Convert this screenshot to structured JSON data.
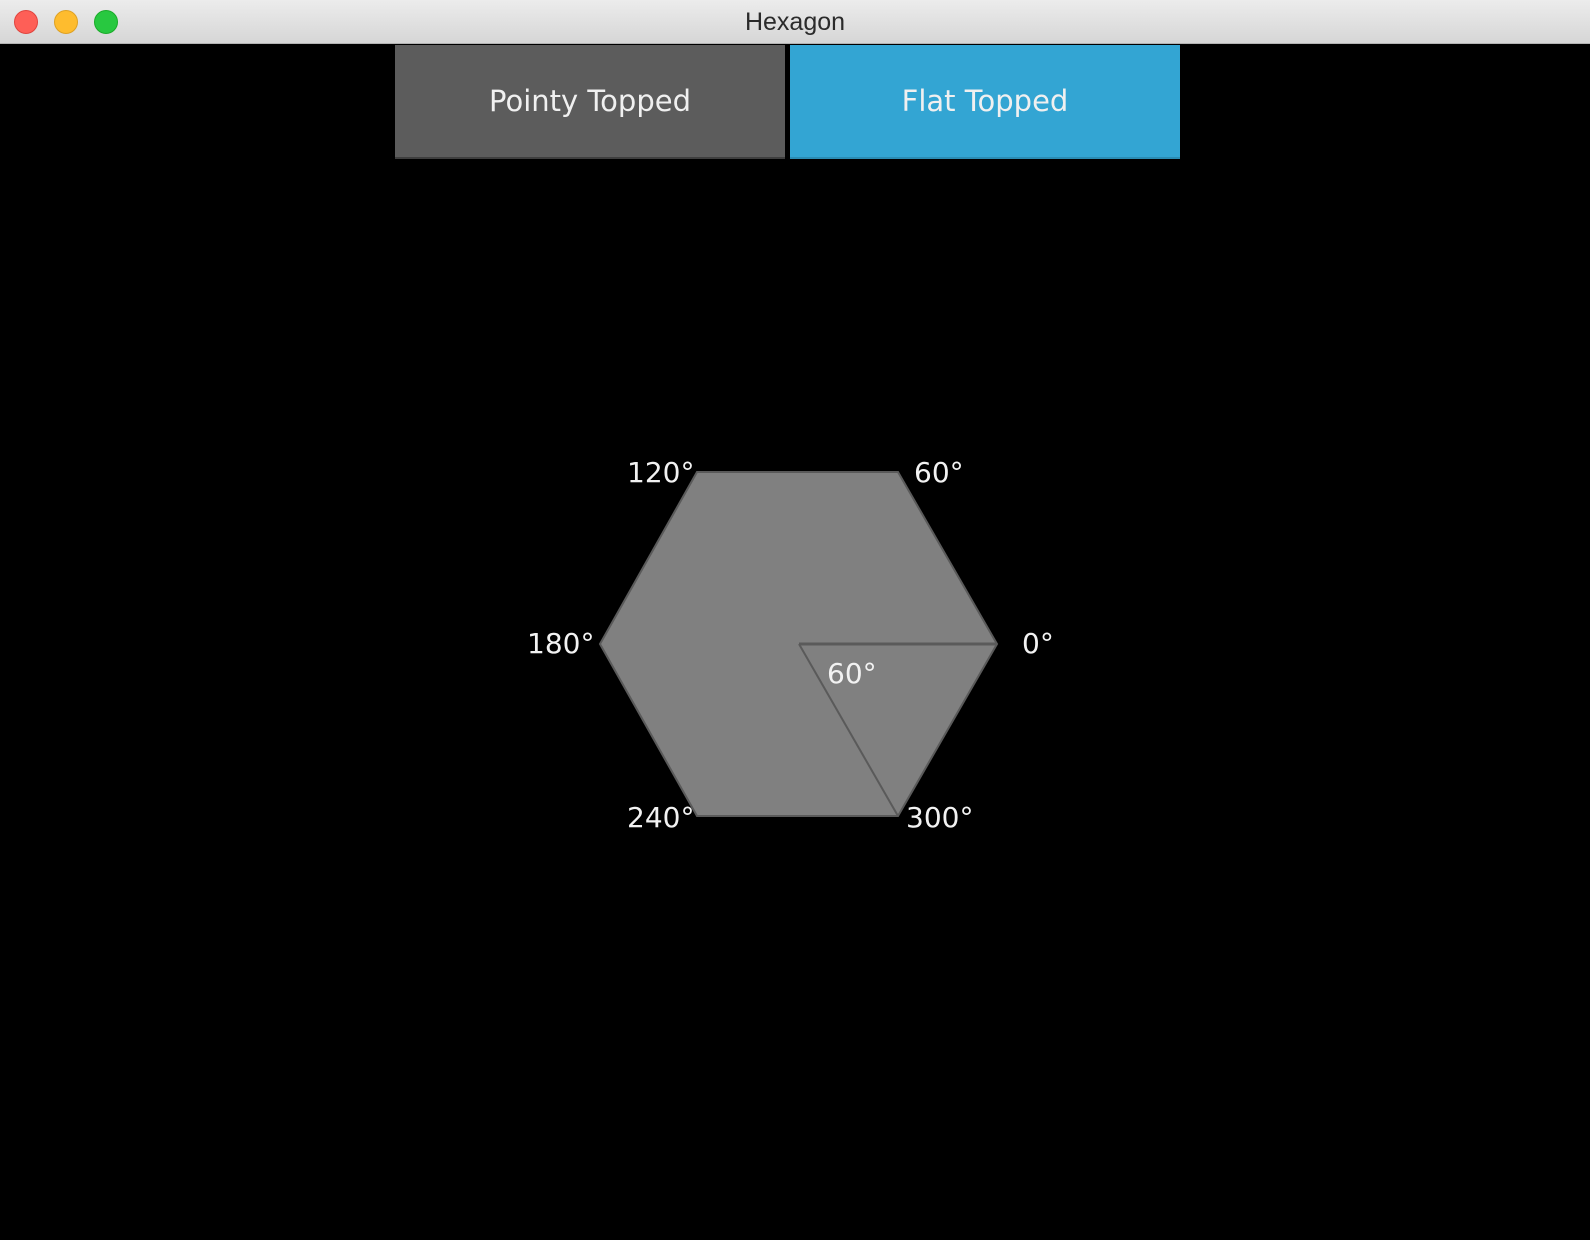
{
  "window": {
    "title": "Hexagon"
  },
  "toolbar": {
    "pointy_label": "Pointy Topped",
    "flat_label": "Flat Topped",
    "selected": "Flat Topped"
  },
  "hexagon": {
    "orientation": "flat",
    "fill_color": "#808080",
    "stroke_color": "#5a5a5a",
    "corner_labels": {
      "deg0": "0°",
      "deg60": "60°",
      "deg120": "120°",
      "deg180": "180°",
      "deg240": "240°",
      "deg300": "300°"
    },
    "center_angle_label": "60°"
  },
  "colors": {
    "selected_button": "#33a5d3",
    "unselected_button": "#5c5c5c",
    "background": "#000000"
  }
}
